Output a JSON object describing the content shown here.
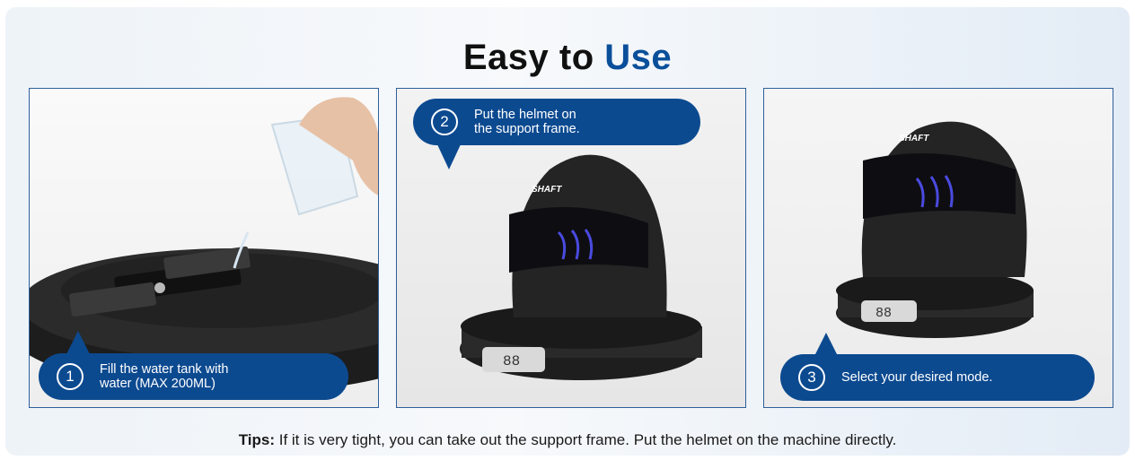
{
  "title": {
    "main": "Easy to",
    "accent": "Use"
  },
  "steps": [
    {
      "number": "1",
      "text_line1": "Fill the water tank with",
      "text_line2": "water (MAX 200ML)"
    },
    {
      "number": "2",
      "text_line1": "Put the helmet on",
      "text_line2": "the support frame."
    },
    {
      "number": "3",
      "text_line1": "Select your desired mode.",
      "text_line2": ""
    }
  ],
  "helmet_brand": "SHAFT",
  "display_reading": "88",
  "tips": {
    "label": "Tips:",
    "text": " If it is very tight, you can take out the support frame. Put the helmet on the machine directly."
  },
  "colors": {
    "accent": "#0a4f9a",
    "bubble": "#0c4a90",
    "border": "#2f5f9a"
  }
}
